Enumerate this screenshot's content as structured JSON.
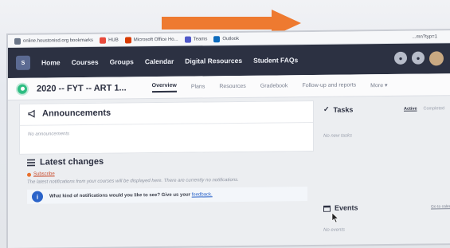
{
  "browser": {
    "bookmarks": [
      {
        "label": "online.houstonisd.org bookmarks",
        "icon": "page-icon",
        "color": "#6b7688"
      },
      {
        "label": "HUB",
        "icon": "hub-icon",
        "color": "#e84a3c"
      },
      {
        "label": "Microsoft Office Ho...",
        "icon": "office-icon",
        "color": "#d83b01"
      },
      {
        "label": "Teams",
        "icon": "teams-icon",
        "color": "#5059c9"
      },
      {
        "label": "Outlook",
        "icon": "outlook-icon",
        "color": "#0f6cbd"
      }
    ],
    "url_fragment": "...mn?typ=1"
  },
  "nav": {
    "links": [
      "Home",
      "Courses",
      "Groups",
      "Calendar",
      "Digital Resources",
      "Student FAQs"
    ]
  },
  "course": {
    "title": "2020 -- FYT -- ART 1...",
    "tabs": [
      "Overview",
      "Plans",
      "Resources",
      "Gradebook",
      "Follow-up and reports",
      "More ▾"
    ],
    "active_tab": "Overview"
  },
  "announcements": {
    "heading": "Announcements",
    "empty": "No announcements"
  },
  "latest": {
    "heading": "Latest changes",
    "subscribe": "Subscribe",
    "message": "The latest notifications from your courses will be displayed here. There are currently no notifications.",
    "notice_text": "What kind of notifications would you like to see? Give us your ",
    "notice_link": "feedback."
  },
  "tasks": {
    "heading": "Tasks",
    "tabs": [
      "Active",
      "Completed"
    ],
    "empty": "No new tasks"
  },
  "events": {
    "heading": "Events",
    "link": "Go to calendar",
    "empty": "No events"
  },
  "colors": {
    "nav_bg": "#2c3142",
    "arrow": "#ee7a30",
    "course_icon": "#2dbd82",
    "info_icon": "#2a63c9"
  }
}
